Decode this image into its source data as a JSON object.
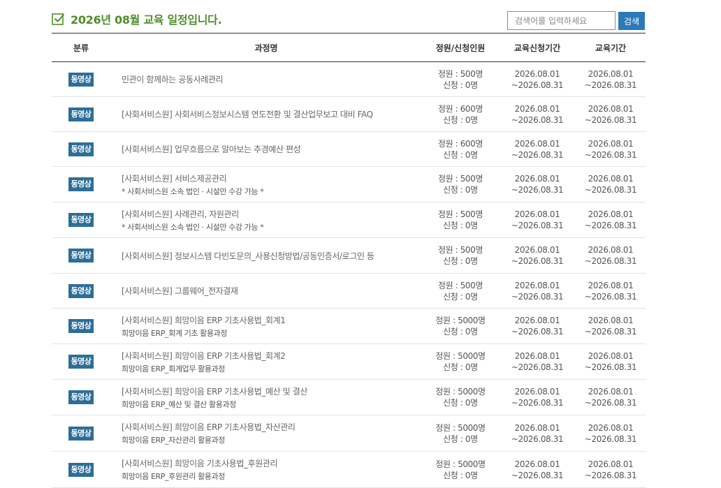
{
  "page": {
    "title": "2026년 08월 교육 일정입니다.",
    "search_placeholder": "검색어를 입력하세요",
    "search_button": "검색"
  },
  "table": {
    "headers": {
      "category": "분류",
      "course": "과정명",
      "capacity": "정원/신청인원",
      "apply_period": "교육신청기간",
      "edu_period": "교육기간"
    },
    "rows": [
      {
        "category": "동영상",
        "title": "민관이 함께하는 공동사례관리",
        "note": "",
        "capacity": "정원 : 500명",
        "applied": "신청 : 0명",
        "apply_start": "2026.08.01",
        "apply_end": "~2026.08.31",
        "edu_start": "2026.08.01",
        "edu_end": "~2026.08.31"
      },
      {
        "category": "동영상",
        "title": "[사회서비스원] 사회서비스정보시스템 연도전환 및 결산업무보고 대비 FAQ",
        "note": "",
        "capacity": "정원 : 600명",
        "applied": "신청 : 0명",
        "apply_start": "2026.08.01",
        "apply_end": "~2026.08.31",
        "edu_start": "2026.08.01",
        "edu_end": "~2026.08.31"
      },
      {
        "category": "동영상",
        "title": "[사회서비스원] 업무흐름으로 알아보는 추경예산 편성",
        "note": "",
        "capacity": "정원 : 600명",
        "applied": "신청 : 0명",
        "apply_start": "2026.08.01",
        "apply_end": "~2026.08.31",
        "edu_start": "2026.08.01",
        "edu_end": "~2026.08.31"
      },
      {
        "category": "동영상",
        "title": "[사회서비스원] 서비스제공관리",
        "note": "* 사회서비스원 소속 법인 · 시설만 수강 가능 *",
        "capacity": "정원 : 500명",
        "applied": "신청 : 0명",
        "apply_start": "2026.08.01",
        "apply_end": "~2026.08.31",
        "edu_start": "2026.08.01",
        "edu_end": "~2026.08.31"
      },
      {
        "category": "동영상",
        "title": "[사회서비스원] 사례관리, 자원관리",
        "note": "* 사회서비스원 소속 법인 · 시설만 수강 가능 *",
        "capacity": "정원 : 500명",
        "applied": "신청 : 0명",
        "apply_start": "2026.08.01",
        "apply_end": "~2026.08.31",
        "edu_start": "2026.08.01",
        "edu_end": "~2026.08.31"
      },
      {
        "category": "동영상",
        "title": "[사회서비스원] 정보시스템 다빈도문의_사용신청방법/공동인증서/로그인 등",
        "note": "",
        "capacity": "정원 : 500명",
        "applied": "신청 : 0명",
        "apply_start": "2026.08.01",
        "apply_end": "~2026.08.31",
        "edu_start": "2026.08.01",
        "edu_end": "~2026.08.31"
      },
      {
        "category": "동영상",
        "title": "[사회서비스원] 그룹웨어_전자결재",
        "note": "",
        "capacity": "정원 : 500명",
        "applied": "신청 : 0명",
        "apply_start": "2026.08.01",
        "apply_end": "~2026.08.31",
        "edu_start": "2026.08.01",
        "edu_end": "~2026.08.31"
      },
      {
        "category": "동영상",
        "title": "[사회서비스원] 희망이음 ERP 기초사용법_회계1",
        "note": "희망이음 ERP_회계 기초 활용과정",
        "capacity": "정원 : 5000명",
        "applied": "신청 : 0명",
        "apply_start": "2026.08.01",
        "apply_end": "~2026.08.31",
        "edu_start": "2026.08.01",
        "edu_end": "~2026.08.31"
      },
      {
        "category": "동영상",
        "title": "[사회서비스원] 희망이음 ERP 기초사용법_회계2",
        "note": "희망이음 ERP_회계업무 활용과정",
        "capacity": "정원 : 5000명",
        "applied": "신청 : 0명",
        "apply_start": "2026.08.01",
        "apply_end": "~2026.08.31",
        "edu_start": "2026.08.01",
        "edu_end": "~2026.08.31"
      },
      {
        "category": "동영상",
        "title": "[사회서비스원] 희망이음 ERP 기초사용법_예산 및 결산",
        "note": "희망이음 ERP_예산 및 결산 활용과정",
        "capacity": "정원 : 5000명",
        "applied": "신청 : 0명",
        "apply_start": "2026.08.01",
        "apply_end": "~2026.08.31",
        "edu_start": "2026.08.01",
        "edu_end": "~2026.08.31"
      },
      {
        "category": "동영상",
        "title": "[사회서비스원] 희망이음 ERP 기초사용법_자산관리",
        "note": "희망이음 ERP_자산관리 활용과정",
        "capacity": "정원 : 5000명",
        "applied": "신청 : 0명",
        "apply_start": "2026.08.01",
        "apply_end": "~2026.08.31",
        "edu_start": "2026.08.01",
        "edu_end": "~2026.08.31"
      },
      {
        "category": "동영상",
        "title": "[사회서비스원] 희망이음 기초사용법_후원관리",
        "note": "희망이음 ERP_후원관리 활용과정",
        "capacity": "정원 : 5000명",
        "applied": "신청 : 0명",
        "apply_start": "2026.08.01",
        "apply_end": "~2026.08.31",
        "edu_start": "2026.08.01",
        "edu_end": "~2026.08.31"
      }
    ]
  },
  "colors": {
    "title_green": "#4f8e2c",
    "badge_blue": "#2d6e98",
    "button_blue": "#2b7ab8"
  },
  "icons": {
    "title_icon": "check-square-icon"
  }
}
